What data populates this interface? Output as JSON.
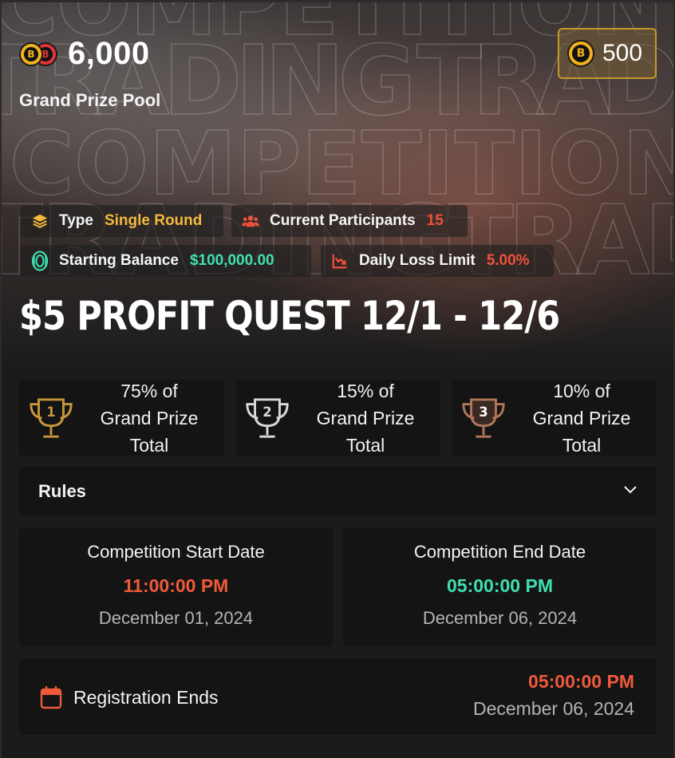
{
  "hero": {
    "background_words": [
      "COMPETITION",
      "TRADING",
      "TRADE"
    ],
    "prize_pool_value": "6,000",
    "prize_pool_label": "Grand Prize Pool",
    "coin_balance": "500"
  },
  "info": {
    "type_label": "Type",
    "type_value": "Single Round",
    "participants_label": "Current Participants",
    "participants_value": "15",
    "starting_balance_label": "Starting Balance",
    "starting_balance_value": "$100,000.00",
    "daily_loss_label": "Daily Loss Limit",
    "daily_loss_value": "5.00%"
  },
  "competition_title": "$5 PROFIT QUEST 12/1 - 12/6",
  "prizes": [
    {
      "rank": "1",
      "line1": "75% of",
      "line2": "Grand Prize",
      "line3": "Total",
      "color": "#c8963a"
    },
    {
      "rank": "2",
      "line1": "15% of",
      "line2": "Grand Prize",
      "line3": "Total",
      "color": "#d9d9d9"
    },
    {
      "rank": "3",
      "line1": "10% of",
      "line2": "Grand Prize",
      "line3": "Total",
      "color": "#b0765a"
    }
  ],
  "rules": {
    "label": "Rules"
  },
  "start": {
    "label": "Competition Start Date",
    "time": "11:00:00 PM",
    "date": "December 01, 2024"
  },
  "end": {
    "label": "Competition End Date",
    "time": "05:00:00 PM",
    "date": "December 06, 2024"
  },
  "registration": {
    "label": "Registration Ends",
    "time": "05:00:00 PM",
    "date": "December 06, 2024"
  },
  "colors": {
    "accent_gold": "#f2b01e",
    "type_value": "#f5b83c",
    "red_value": "#f0503c",
    "green_value": "#3fe0b0",
    "start_time": "#f05a3a",
    "end_time": "#3fe0b0"
  }
}
